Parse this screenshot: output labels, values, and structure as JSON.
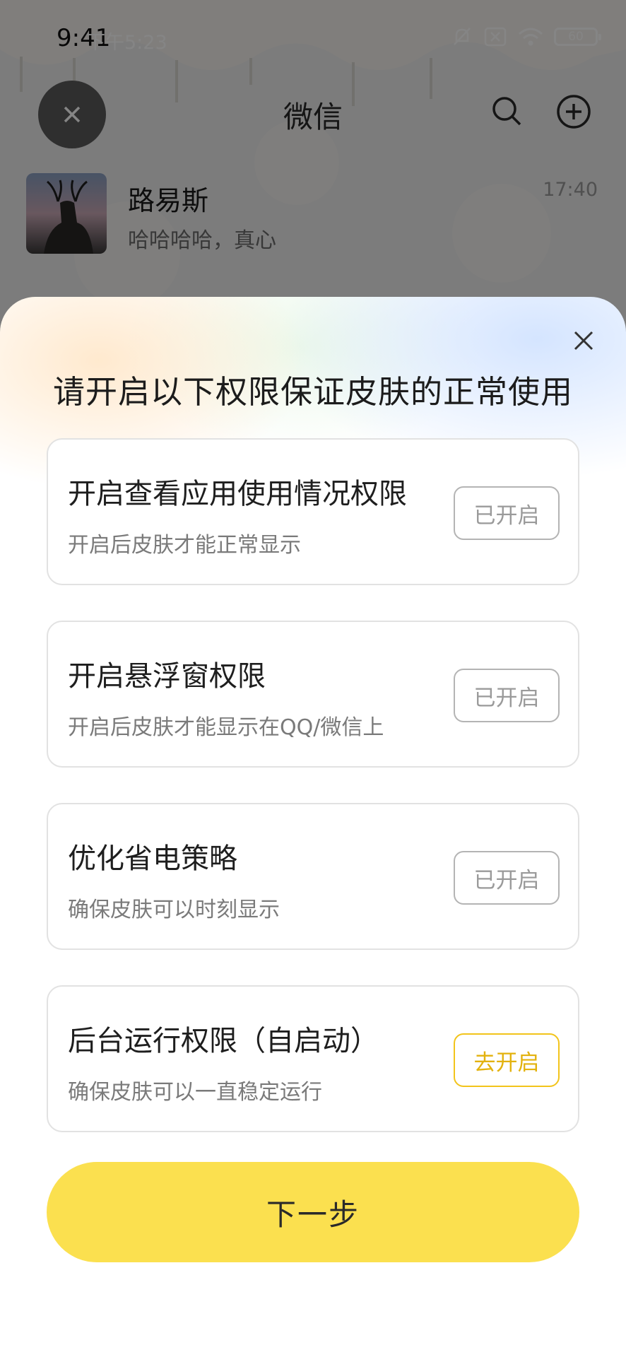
{
  "status_bar": {
    "time_primary": "9:41",
    "time_secondary": "下午5:23",
    "battery": "60"
  },
  "background_app": {
    "title": "微信",
    "chat": {
      "name": "路易斯",
      "preview": "哈哈哈哈，真心",
      "time": "17:40"
    }
  },
  "sheet": {
    "title": "请开启以下权限保证皮肤的正常使用",
    "permissions": [
      {
        "title": "开启查看应用使用情况权限",
        "subtitle": "开启后皮肤才能正常显示",
        "button": "已开启",
        "state": "enabled"
      },
      {
        "title": "开启悬浮窗权限",
        "subtitle": "开启后皮肤才能显示在QQ/微信上",
        "button": "已开启",
        "state": "enabled"
      },
      {
        "title": "优化省电策略",
        "subtitle": "确保皮肤可以时刻显示",
        "button": "已开启",
        "state": "enabled"
      },
      {
        "title": "后台运行权限（自启动）",
        "subtitle": "确保皮肤可以一直稳定运行",
        "button": "去开启",
        "state": "disabled"
      }
    ],
    "next_label": "下一步"
  },
  "colors": {
    "accent_yellow": "#fbe04f",
    "go_border": "#f2c41b",
    "enabled_border": "#b4b4b4"
  }
}
